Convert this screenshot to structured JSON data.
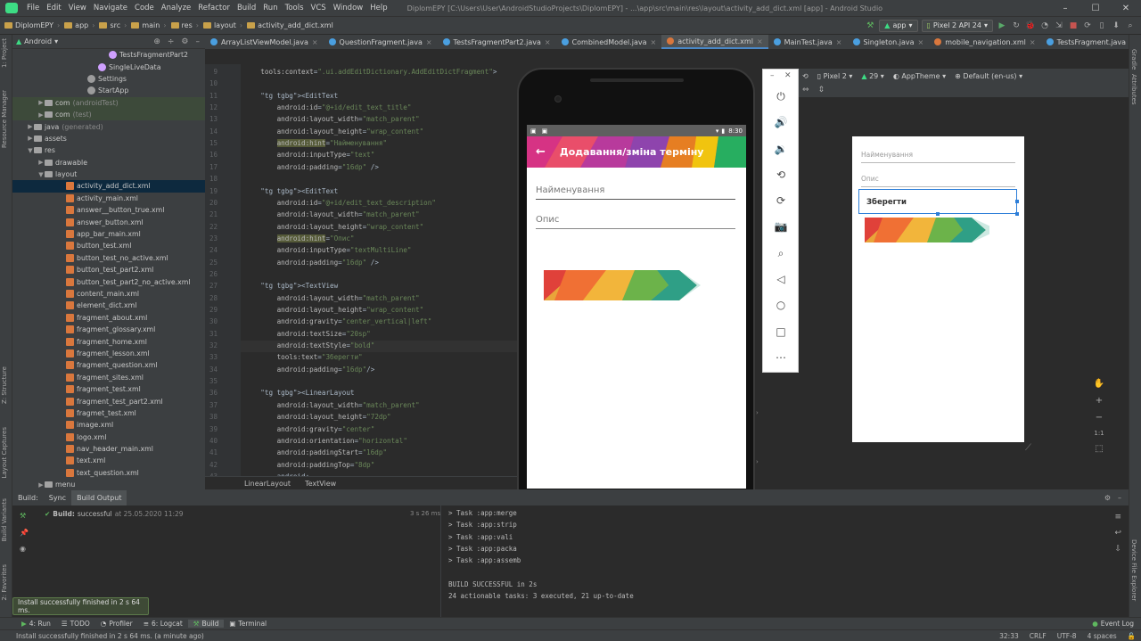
{
  "menubar": {
    "items": [
      "File",
      "Edit",
      "View",
      "Navigate",
      "Code",
      "Analyze",
      "Refactor",
      "Build",
      "Run",
      "Tools",
      "VCS",
      "Window",
      "Help"
    ],
    "window_title": "DiplomEPY [C:\\Users\\User\\AndroidStudioProjects\\DiplomEPY] - ...\\app\\src\\main\\res\\layout\\activity_add_dict.xml [app] - Android Studio"
  },
  "navbar": {
    "crumbs": [
      "DiplomEPY",
      "app",
      "src",
      "main",
      "res",
      "layout",
      "activity_add_dict.xml"
    ],
    "run_config": "app",
    "device": "Pixel 2 API 24"
  },
  "project": {
    "view_label": "Android",
    "tree": [
      {
        "label": "TestsFragmentPart2",
        "indent": 110,
        "icon": "kt"
      },
      {
        "label": "SingleLiveData",
        "indent": 98,
        "icon": "kt"
      },
      {
        "label": "Settings",
        "indent": 86,
        "icon": "set"
      },
      {
        "label": "StartApp",
        "indent": 86,
        "icon": "set"
      },
      {
        "label": "com",
        "extra": "(androidTest)",
        "indent": 38,
        "icon": "folder",
        "arrow": "▶",
        "hl": true
      },
      {
        "label": "com",
        "extra": "(test)",
        "indent": 38,
        "icon": "folder",
        "arrow": "▶",
        "hl": true
      },
      {
        "label": "java",
        "extra": "(generated)",
        "indent": 26,
        "icon": "folder",
        "arrow": "▶"
      },
      {
        "label": "assets",
        "indent": 26,
        "icon": "folder",
        "arrow": "▶"
      },
      {
        "label": "res",
        "indent": 26,
        "icon": "folder",
        "arrow": "▼"
      },
      {
        "label": "drawable",
        "indent": 38,
        "icon": "folder",
        "arrow": "▶"
      },
      {
        "label": "layout",
        "indent": 38,
        "icon": "folder",
        "arrow": "▼"
      },
      {
        "label": "activity_add_dict.xml",
        "indent": 62,
        "icon": "xml",
        "sel": true
      },
      {
        "label": "activity_main.xml",
        "indent": 62,
        "icon": "xml"
      },
      {
        "label": "answer__button_true.xml",
        "indent": 62,
        "icon": "xml"
      },
      {
        "label": "answer_button.xml",
        "indent": 62,
        "icon": "xml"
      },
      {
        "label": "app_bar_main.xml",
        "indent": 62,
        "icon": "xml"
      },
      {
        "label": "button_test.xml",
        "indent": 62,
        "icon": "xml"
      },
      {
        "label": "button_test_no_active.xml",
        "indent": 62,
        "icon": "xml"
      },
      {
        "label": "button_test_part2.xml",
        "indent": 62,
        "icon": "xml"
      },
      {
        "label": "button_test_part2_no_active.xml",
        "indent": 62,
        "icon": "xml"
      },
      {
        "label": "content_main.xml",
        "indent": 62,
        "icon": "xml"
      },
      {
        "label": "element_dict.xml",
        "indent": 62,
        "icon": "xml"
      },
      {
        "label": "fragment_about.xml",
        "indent": 62,
        "icon": "xml"
      },
      {
        "label": "fragment_glossary.xml",
        "indent": 62,
        "icon": "xml"
      },
      {
        "label": "fragment_home.xml",
        "indent": 62,
        "icon": "xml"
      },
      {
        "label": "fragment_lesson.xml",
        "indent": 62,
        "icon": "xml"
      },
      {
        "label": "fragment_question.xml",
        "indent": 62,
        "icon": "xml"
      },
      {
        "label": "fragment_sites.xml",
        "indent": 62,
        "icon": "xml"
      },
      {
        "label": "fragment_test.xml",
        "indent": 62,
        "icon": "xml"
      },
      {
        "label": "fragment_test_part2.xml",
        "indent": 62,
        "icon": "xml"
      },
      {
        "label": "fragmet_test.xml",
        "indent": 62,
        "icon": "xml"
      },
      {
        "label": "image.xml",
        "indent": 62,
        "icon": "xml"
      },
      {
        "label": "logo.xml",
        "indent": 62,
        "icon": "xml"
      },
      {
        "label": "nav_header_main.xml",
        "indent": 62,
        "icon": "xml"
      },
      {
        "label": "text.xml",
        "indent": 62,
        "icon": "xml"
      },
      {
        "label": "text_question.xml",
        "indent": 62,
        "icon": "xml"
      },
      {
        "label": "menu",
        "indent": 38,
        "icon": "folder",
        "arrow": "▶"
      }
    ]
  },
  "left_strip": [
    "1: Project",
    "Resource Manager",
    "Z: Structure",
    "Layout Captures",
    "Build Variants",
    "2: Favorites"
  ],
  "right_strip": [
    "Gradle",
    "Attributes",
    "Device File Explorer"
  ],
  "tabs": [
    "ArrayListViewModel.java",
    "QuestionFragment.java",
    "TestsFragmentPart2.java",
    "CombinedModel.java",
    "activity_add_dict.xml",
    "MainTest.java",
    "Singleton.java",
    "mobile_navigation.xml",
    "TestsFragment.java",
    "MainViewM"
  ],
  "active_tab": 4,
  "code": {
    "line_numbers": [
      "9",
      "10",
      "11",
      "12",
      "13",
      "14",
      "15",
      "16",
      "17",
      "18",
      "19",
      "20",
      "21",
      "22",
      "23",
      "24",
      "25",
      "26",
      "27",
      "28",
      "29",
      "30",
      "31",
      "32",
      "33",
      "34",
      "35",
      "36",
      "37",
      "38",
      "39",
      "40",
      "41",
      "42",
      "43"
    ],
    "lines": [
      "    tools:context=\".ui.addEditDictionary.AddEditDictFragment\">",
      "",
      "    <EditText",
      "        android:id=\"@+id/edit_text_title\"",
      "        android:layout_width=\"match_parent\"",
      "        android:layout_height=\"wrap_content\"",
      "        android:hint=\"Найменування\"",
      "        android:inputType=\"text\"",
      "        android:padding=\"16dp\" />",
      "",
      "    <EditText",
      "        android:id=\"@+id/edit_text_description\"",
      "        android:layout_width=\"match_parent\"",
      "        android:layout_height=\"wrap_content\"",
      "        android:hint=\"Опис\"",
      "        android:inputType=\"textMultiLine\"",
      "        android:padding=\"16dp\" />",
      "",
      "    <TextView",
      "        android:layout_width=\"match_parent\"",
      "        android:layout_height=\"wrap_content\"",
      "        android:gravity=\"center_vertical|left\"",
      "        android:textSize=\"20sp\"",
      "        android:textStyle=\"bold\"",
      "        tools:text=\"Зберегти\"",
      "        android:padding=\"16dp\"/>",
      "",
      "    <LinearLayout",
      "        android:layout_width=\"match_parent\"",
      "        android:layout_height=\"72dp\"",
      "        android:gravity=\"center\"",
      "        android:orientation=\"horizontal\"",
      "        android:paddingStart=\"16dp\"",
      "        android:paddingTop=\"8dp\"",
      "        android:..."
    ],
    "breadcrumb": [
      "LinearLayout",
      "TextView"
    ]
  },
  "design": {
    "device": "Pixel 2",
    "api": "29",
    "theme": "AppTheme",
    "locale": "Default (en-us)",
    "preview": {
      "hint_title": "Найменування",
      "hint_desc": "Опис",
      "save_text": "Зберегти"
    },
    "zoom_label": "1:1"
  },
  "emulator": {
    "status_time": "8:30",
    "app_title": "Додавання/зміна терміну",
    "field_title_hint": "Найменування",
    "field_desc_hint": "Опис",
    "side_icons": [
      "power-icon",
      "volume-up-icon",
      "volume-down-icon",
      "rotate-left-icon",
      "rotate-right-icon",
      "camera-icon",
      "zoom-icon",
      "back-icon",
      "home-icon",
      "overview-icon",
      "more-icon"
    ]
  },
  "build": {
    "tabs": [
      "Build:",
      "Sync",
      "Build Output"
    ],
    "status_label": "Build:",
    "status_value": "successful",
    "status_time": "at 25.05.2020 11:29",
    "duration": "3 s 26 ms",
    "output_lines": [
      "> Task :app:merge",
      "> Task :app:strip",
      "> Task :app:vali",
      "> Task :app:packa",
      "> Task :app:assemb",
      "",
      "BUILD SUCCESSFUL in 2s",
      "24 actionable tasks: 3 executed, 21 up-to-date"
    ]
  },
  "toast": "Install successfully finished in 2 s 64 ms.",
  "toolwindows": [
    "4: Run",
    "TODO",
    "Profiler",
    "6: Logcat",
    "Build",
    "Terminal"
  ],
  "event_log": "Event Log",
  "statusline": {
    "message": "Install successfully finished in 2 s 64 ms. (a minute ago)",
    "pos": "32:33",
    "eol": "CRLF",
    "enc": "UTF-8",
    "indent": "4 spaces"
  },
  "colors": {
    "accent": "#4a88c7",
    "selection": "#0d293e",
    "tag": "#e8bf6a",
    "string": "#6a8759"
  }
}
